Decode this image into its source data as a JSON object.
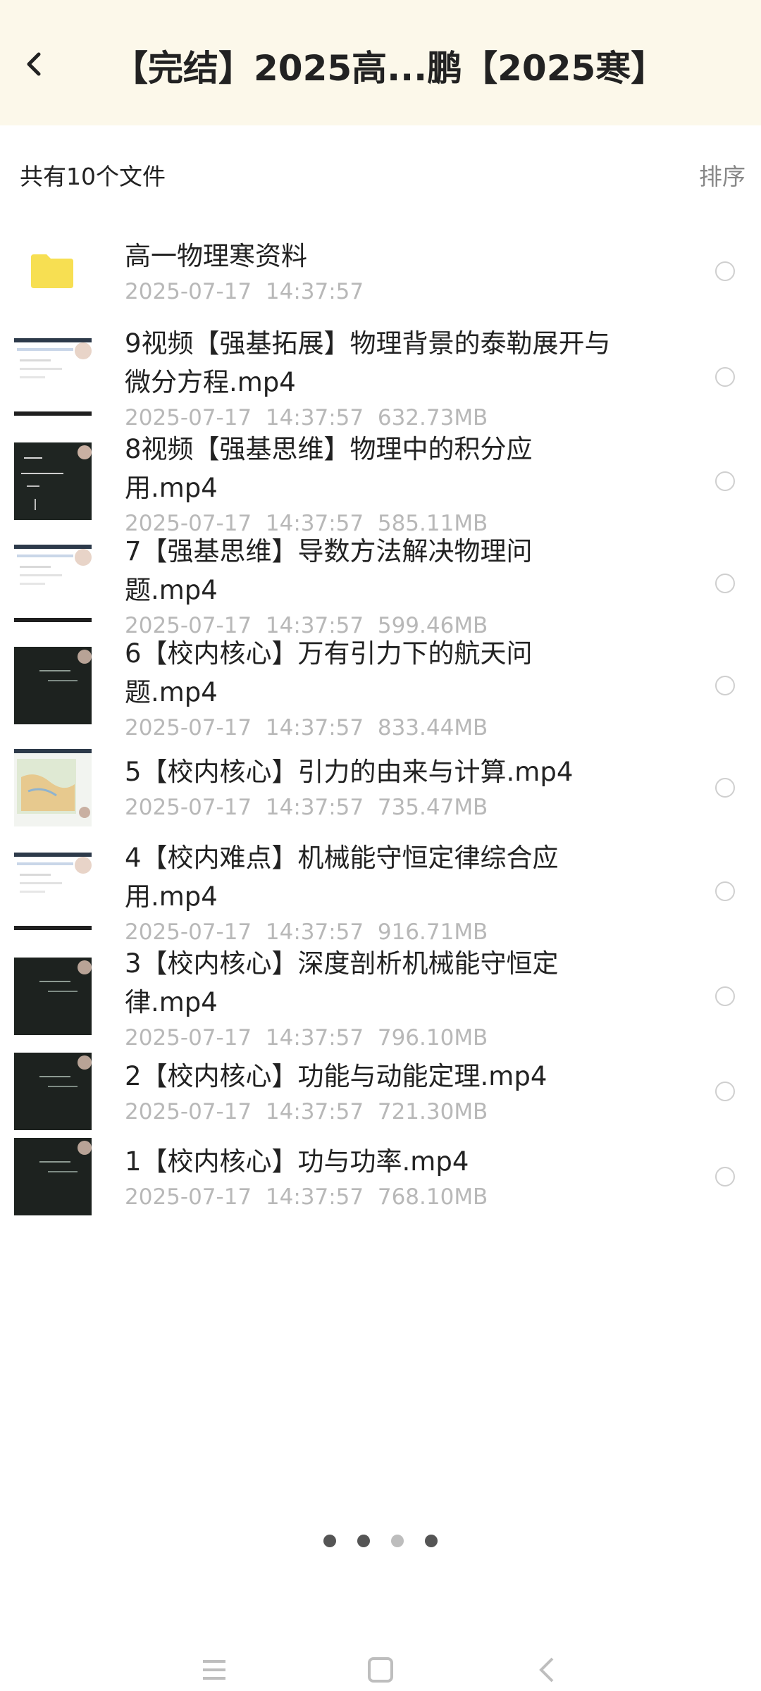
{
  "header": {
    "back_icon": "chevron-left-icon",
    "title": "【完结】2025高...鹏【2025寒】"
  },
  "summary": {
    "file_count_text": "共有10个文件",
    "sort_label": "排序"
  },
  "files": [
    {
      "name": "高一物理寒资料",
      "date": "2025-07-17",
      "time": "14:37:57",
      "size": "",
      "type": "folder",
      "thumb_icon": "folder-icon"
    },
    {
      "name": "9视频【强基拓展】物理背景的泰勒展开与\n微分方程.mp4",
      "date": "2025-07-17",
      "time": "14:37:57",
      "size": "632.73MB",
      "type": "video",
      "thumb_icon": "video-thumbnail-light"
    },
    {
      "name": "8视频【强基思维】物理中的积分应\n用.mp4",
      "date": "2025-07-17",
      "time": "14:37:57",
      "size": "585.11MB",
      "type": "video",
      "thumb_icon": "video-thumbnail-blackboard"
    },
    {
      "name": "7【强基思维】导数方法解决物理问\n题.mp4",
      "date": "2025-07-17",
      "time": "14:37:57",
      "size": "599.46MB",
      "type": "video",
      "thumb_icon": "video-thumbnail-light"
    },
    {
      "name": "6【校内核心】万有引力下的航天问\n题.mp4",
      "date": "2025-07-17",
      "time": "14:37:57",
      "size": "833.44MB",
      "type": "video",
      "thumb_icon": "video-thumbnail-dark"
    },
    {
      "name": "5【校内核心】引力的由来与计算.mp4",
      "date": "2025-07-17",
      "time": "14:37:57",
      "size": "735.47MB",
      "type": "video",
      "thumb_icon": "video-thumbnail-map"
    },
    {
      "name": "4【校内难点】机械能守恒定律综合应\n用.mp4",
      "date": "2025-07-17",
      "time": "14:37:57",
      "size": "916.71MB",
      "type": "video",
      "thumb_icon": "video-thumbnail-light"
    },
    {
      "name": "3【校内核心】深度剖析机械能守恒定\n律.mp4",
      "date": "2025-07-17",
      "time": "14:37:57",
      "size": "796.10MB",
      "type": "video",
      "thumb_icon": "video-thumbnail-dark"
    },
    {
      "name": "2【校内核心】功能与动能定理.mp4",
      "date": "2025-07-17",
      "time": "14:37:57",
      "size": "721.30MB",
      "type": "video",
      "thumb_icon": "video-thumbnail-dark"
    },
    {
      "name": "1【校内核心】功与功率.mp4",
      "date": "2025-07-17",
      "time": "14:37:57",
      "size": "768.10MB",
      "type": "video",
      "thumb_icon": "video-thumbnail-dark"
    }
  ],
  "pager": {
    "pages": 4,
    "active_pages": [
      1,
      2,
      4
    ]
  },
  "system_nav": {
    "icons": [
      "menu-icon",
      "home-icon",
      "back-icon"
    ]
  },
  "colors": {
    "header_bg": "#fcf8ea",
    "folder": "#f7df52",
    "text_primary": "#222222",
    "text_meta": "#b8b8b8",
    "text_secondary": "#888888"
  }
}
